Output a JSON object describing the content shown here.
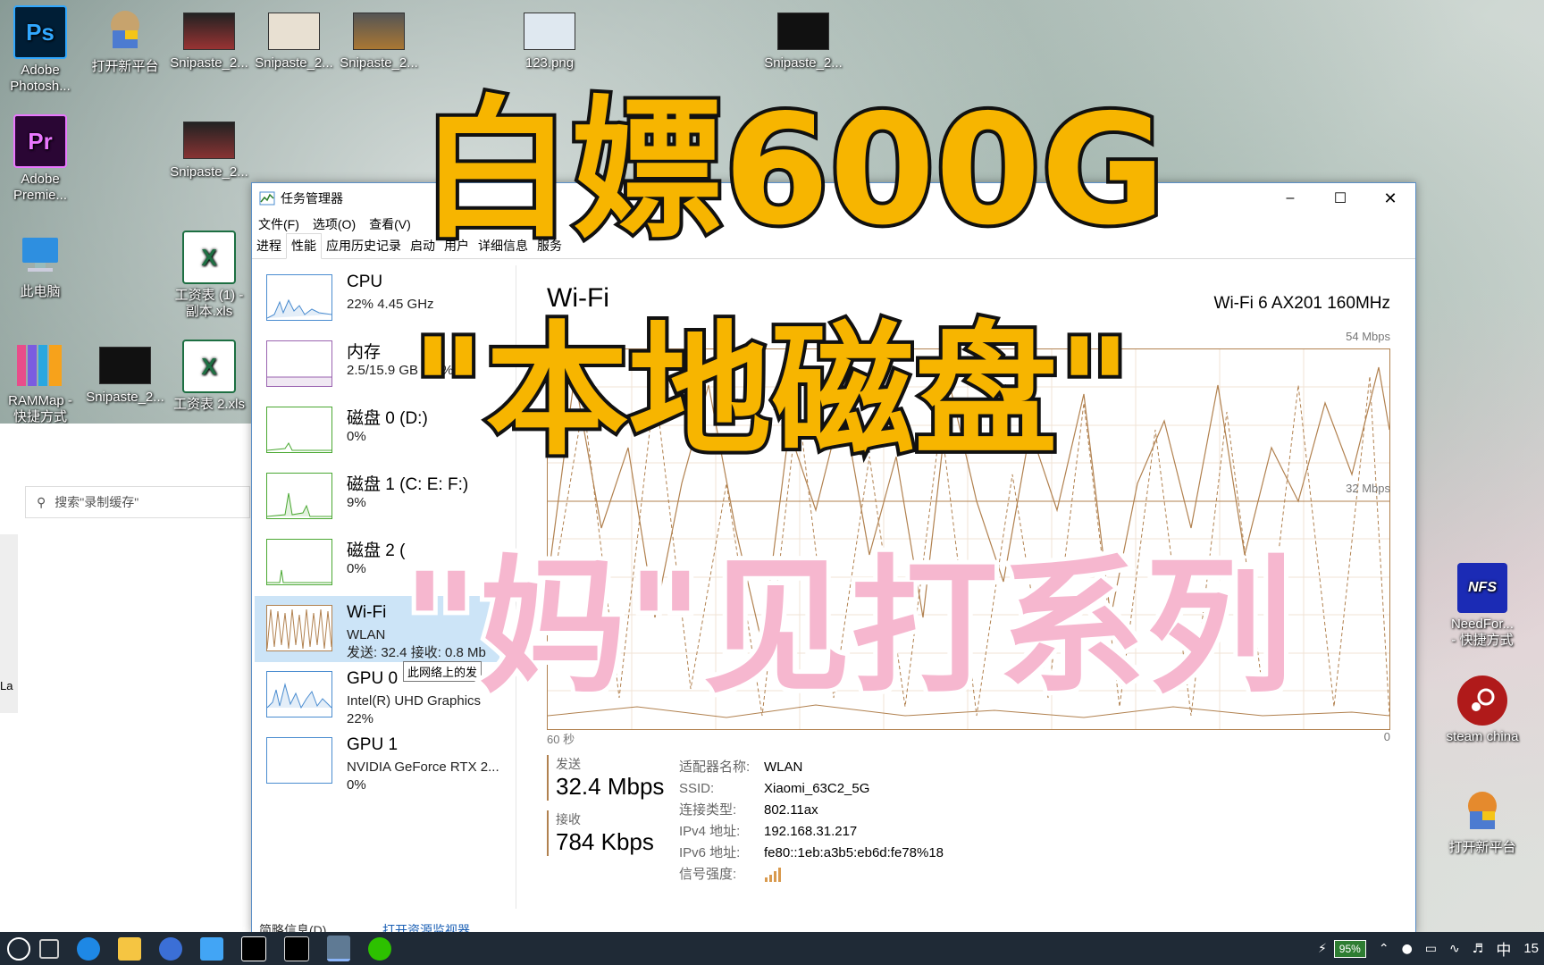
{
  "desktop": {
    "icons_left": [
      {
        "label": "Adobe\nPhotosh...",
        "icon": "photoshop-icon",
        "badge": "Ps"
      },
      {
        "label": "Adobe\nPremie...",
        "icon": "premiere-icon",
        "badge": "Pr"
      },
      {
        "label": "此电脑",
        "icon": "computer-icon"
      },
      {
        "label": "RAMMap -\n快捷方式",
        "icon": "rammap-icon"
      }
    ],
    "icons_col2": [
      {
        "label": "打开新平台"
      },
      {
        "label": "Snipaste_2..."
      }
    ],
    "icons_top": [
      {
        "label": "Snipaste_2..."
      },
      {
        "label": "Snipaste_2..."
      },
      {
        "label": "Snipaste_2..."
      },
      {
        "label": "123.png"
      },
      {
        "label": "Snipaste_2..."
      }
    ],
    "icons_row2": [
      {
        "label": "Snipaste_2..."
      },
      {
        "label": "工资表 (1) -\n副本.xls",
        "badge": "X"
      },
      {
        "label": "工资表 2.xls",
        "badge": "X"
      }
    ],
    "icons_right": [
      {
        "label": "NeedFor...\n- 快捷方式",
        "badge": "NFS"
      },
      {
        "label": "steam china"
      },
      {
        "label": "打开新平台"
      }
    ]
  },
  "explorer": {
    "search_placeholder": "搜索\"录制缓存\"",
    "partial_label": "La"
  },
  "task_manager": {
    "title": "任务管理器",
    "menu": [
      "文件(F)",
      "选项(O)",
      "查看(V)"
    ],
    "tabs": [
      "进程",
      "性能",
      "应用历史记录",
      "启动",
      "用户",
      "详细信息",
      "服务"
    ],
    "active_tab": "性能",
    "sidebar": [
      {
        "name": "CPU",
        "detail": "22% 4.45 GHz",
        "color": "#4a8cd0"
      },
      {
        "name": "内存",
        "detail": "2.5/15.9 GB (16%)",
        "color": "#9a63b0"
      },
      {
        "name": "磁盘 0 (D:)",
        "detail": "0%",
        "color": "#4aa832"
      },
      {
        "name": "磁盘 1 (C: E: F:)",
        "detail": "9%",
        "color": "#4aa832"
      },
      {
        "name": "磁盘 2 (",
        "detail": "0%",
        "color": "#4aa832"
      },
      {
        "name": "Wi-Fi",
        "detail": "WLAN",
        "detail2": "发送: 32.4 接收: 0.8 Mb",
        "color": "#b1814f",
        "selected": true
      },
      {
        "name": "GPU 0",
        "detail": "Intel(R) UHD Graphics",
        "detail2": "22%",
        "color": "#4a8cd0"
      },
      {
        "name": "GPU 1",
        "detail": "NVIDIA GeForce RTX 2...",
        "detail2": "0%",
        "color": "#4a8cd0"
      }
    ],
    "tooltip": "此网络上的发",
    "main": {
      "heading": "Wi-Fi",
      "adapter_title": "Wi-Fi 6 AX201 160MHz",
      "adapter_prefix": "…",
      "ymax_label": "54 Mbps",
      "ymid_label": "32 Mbps",
      "x_left_label": "60 秒",
      "x_right_label": "0",
      "send_label": "发送",
      "send_value": "32.4 Mbps",
      "recv_label": "接收",
      "recv_value": "784 Kbps",
      "props": [
        {
          "k": "适配器名称:",
          "v": "WLAN"
        },
        {
          "k": "SSID:",
          "v": "Xiaomi_63C2_5G"
        },
        {
          "k": "连接类型:",
          "v": "802.11ax"
        },
        {
          "k": "IPv4 地址:",
          "v": "192.168.31.217"
        },
        {
          "k": "IPv6 地址:",
          "v": "fe80::1eb:a3b5:eb6d:fe78%18"
        },
        {
          "k": "信号强度:",
          "v": ""
        }
      ],
      "footer_left": "简略信息(D)",
      "footer_link": "打开资源监视器"
    }
  },
  "overlay": {
    "line1": "白嫖600G",
    "line2": "\"本地磁盘\"",
    "line3": "\"妈\"见打系列",
    "yellow": "#f7b500",
    "pink": "#f6b7cf"
  },
  "taskbar": {
    "battery": "95%",
    "ime": "中",
    "clock": "15"
  }
}
